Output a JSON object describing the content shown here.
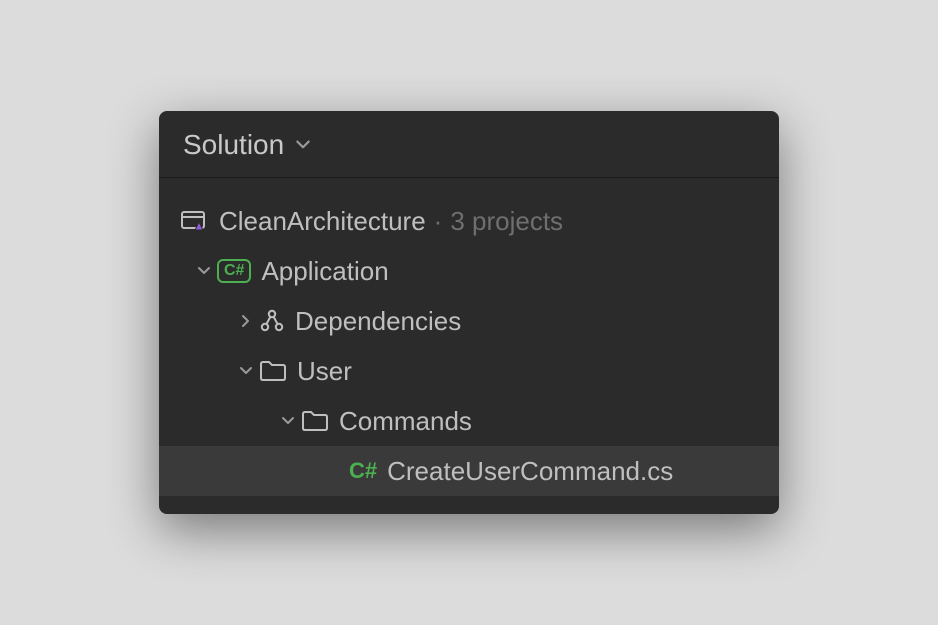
{
  "header": {
    "title": "Solution"
  },
  "tree": {
    "solution": {
      "name": "CleanArchitecture",
      "projectsLabel": "3 projects"
    },
    "nodes": {
      "application": {
        "label": "Application",
        "badge": "C#"
      },
      "dependencies": {
        "label": "Dependencies"
      },
      "user": {
        "label": "User"
      },
      "commands": {
        "label": "Commands"
      },
      "createUserCommand": {
        "badge": "C#",
        "label": "CreateUserCommand.cs"
      }
    }
  }
}
